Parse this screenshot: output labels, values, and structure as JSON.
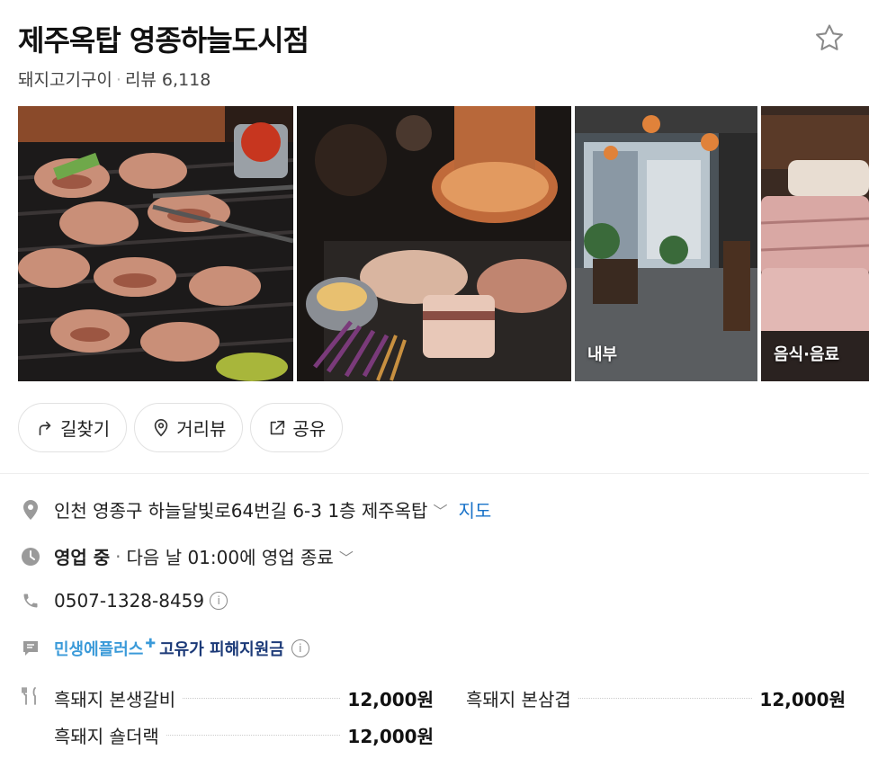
{
  "header": {
    "title": "제주옥탑 영종하늘도시점",
    "category": "돼지고기구이",
    "review_label": "리뷰 6,118"
  },
  "photos": [
    {
      "label": ""
    },
    {
      "label": ""
    },
    {
      "label": "내부"
    },
    {
      "label": "음식·음료"
    }
  ],
  "actions": [
    {
      "label": "길찾기",
      "icon": "directions-icon"
    },
    {
      "label": "거리뷰",
      "icon": "location-pin-icon"
    },
    {
      "label": "공유",
      "icon": "share-icon"
    }
  ],
  "info": {
    "address": "인천 영종구 하늘달빛로64번길 6-3 1층 제주옥탑",
    "map_link": "지도",
    "status": "영업 중",
    "hours": "다음 날 01:00에 영업 종료",
    "phone": "0507-1328-8459",
    "promo_brand": "민생에플러스",
    "promo_text": "고유가 피해지원금"
  },
  "menu": [
    {
      "name": "흑돼지 본생갈비",
      "price": "12,000원"
    },
    {
      "name": "흑돼지 본삼겹",
      "price": "12,000원"
    },
    {
      "name": "흑돼지 숄더랙",
      "price": "12,000원"
    }
  ],
  "colors": {
    "link": "#1a73c9",
    "promo": "#3a9ad9",
    "icon_grey": "#9a9a9a"
  }
}
